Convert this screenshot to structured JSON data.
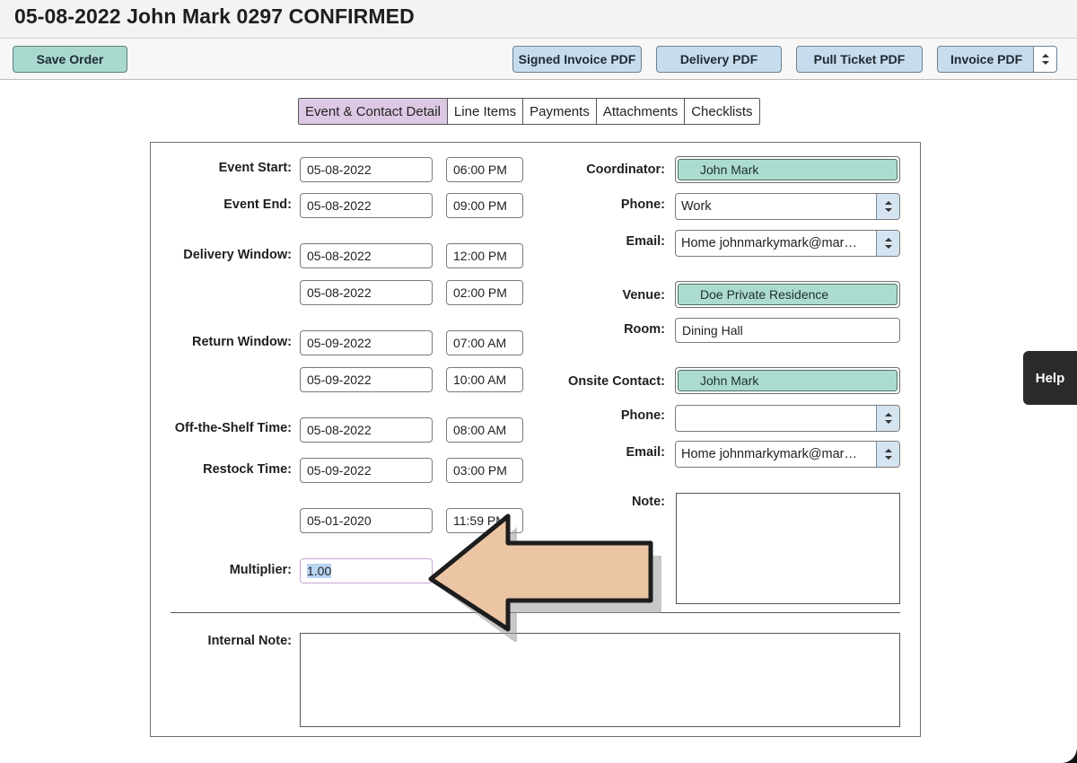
{
  "header": {
    "title": "05-08-2022 John Mark 0297 CONFIRMED"
  },
  "toolbar": {
    "save_label": "Save Order",
    "signed_invoice_label": "Signed Invoice PDF",
    "delivery_label": "Delivery PDF",
    "pull_ticket_label": "Pull Ticket PDF",
    "invoice_label": "Invoice PDF"
  },
  "tabs": [
    "Event & Contact Detail",
    "Line Items",
    "Payments",
    "Attachments",
    "Checklists"
  ],
  "form": {
    "event_start": {
      "label": "Event Start:",
      "date": "05-08-2022",
      "time": "06:00 PM"
    },
    "event_end": {
      "label": "Event End:",
      "date": "05-08-2022",
      "time": "09:00 PM"
    },
    "delivery_window": {
      "label": "Delivery Window:",
      "start_date": "05-08-2022",
      "start_time": "12:00 PM",
      "end_date": "05-08-2022",
      "end_time": "02:00 PM"
    },
    "return_window": {
      "label": "Return Window:",
      "start_date": "05-09-2022",
      "start_time": "07:00 AM",
      "end_date": "05-09-2022",
      "end_time": "10:00 AM"
    },
    "off_shelf": {
      "label": "Off-the-Shelf Time:",
      "date": "05-08-2022",
      "time": "08:00 AM"
    },
    "restock": {
      "label": "Restock Time:",
      "date": "05-09-2022",
      "time": "03:00 PM"
    },
    "extra": {
      "date": "05-01-2020",
      "time": "11:59 PM"
    },
    "multiplier": {
      "label": "Multiplier:",
      "value": "1.00"
    },
    "internal_note": {
      "label": "Internal Note:"
    },
    "coordinator": {
      "label": "Coordinator:",
      "value": "John Mark"
    },
    "phone": {
      "label": "Phone:",
      "value": "Work"
    },
    "email": {
      "label": "Email:",
      "value": "Home johnmarkymark@mar…"
    },
    "venue": {
      "label": "Venue:",
      "value": "Doe Private Residence"
    },
    "room": {
      "label": "Room:",
      "value": "Dining Hall"
    },
    "onsite_contact": {
      "label": "Onsite Contact:",
      "value": "John Mark"
    },
    "onsite_phone": {
      "label": "Phone:",
      "value": ""
    },
    "onsite_email": {
      "label": "Email:",
      "value": "Home johnmarkymark@mar…"
    },
    "note": {
      "label": "Note:"
    }
  },
  "help": {
    "label": "Help"
  },
  "colors": {
    "green_button": "#a9d8cf",
    "blue_button": "#c7dcec",
    "active_tab": "#dcc8e3",
    "chip": "#abdccf",
    "arrow_fill": "#ebc5a4"
  },
  "icons": {
    "select_handle": "up-down-chevron-icon",
    "annotation": "left-arrow-annotation-icon"
  }
}
